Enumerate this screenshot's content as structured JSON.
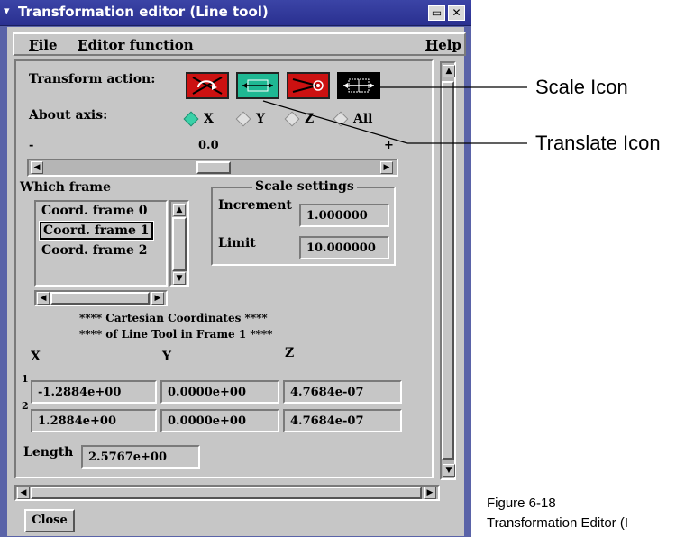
{
  "window": {
    "title": "Transformation editor (Line tool)",
    "minimize_symbol": "▭",
    "close_symbol": "✕"
  },
  "menu": {
    "file": {
      "underline": "F",
      "rest": "ile"
    },
    "editor_function": {
      "underline": "E",
      "rest": "ditor function"
    },
    "help": {
      "underline": "H",
      "rest": "elp"
    }
  },
  "transform_action": {
    "label": "Transform action:",
    "icons": [
      "rotate-icon",
      "translate-icon",
      "stretch-icon",
      "scale-icon"
    ]
  },
  "about_axis": {
    "label": "About axis:",
    "options": [
      "X",
      "Y",
      "Z",
      "All"
    ],
    "selected": "X"
  },
  "slider": {
    "min_label": "-",
    "value_label": "0.0",
    "max_label": "+"
  },
  "which_frame": {
    "label": "Which frame",
    "items": [
      "Coord. frame 0",
      "Coord. frame 1",
      "Coord. frame 2"
    ],
    "selected_index": 1
  },
  "scale_settings": {
    "title": "Scale settings",
    "increment_label": "Increment",
    "increment_value": "1.000000",
    "limit_label": "Limit",
    "limit_value": "10.000000"
  },
  "coords": {
    "heading_1": "**** Cartesian Coordinates ****",
    "heading_2": "**** of Line Tool in Frame 1 ****",
    "col_x": "X",
    "col_y": "Y",
    "col_z": "Z",
    "row_labels": [
      "1",
      "2"
    ],
    "rows": [
      [
        "-1.2884e+00",
        "0.0000e+00",
        "4.7684e-07"
      ],
      [
        "1.2884e+00",
        "0.0000e+00",
        "4.7684e-07"
      ]
    ],
    "length_label": "Length",
    "length_value": "2.5767e+00"
  },
  "buttons": {
    "close": "Close"
  },
  "annotations": {
    "scale_icon": "Scale Icon",
    "translate_icon": "Translate Icon",
    "figure_number": "Figure 6-18",
    "figure_caption": "Transformation Editor (I"
  },
  "colors": {
    "title_bar": "#2a3090",
    "panel": "#c6c6c6",
    "radio_selected": "#3ad1a8",
    "rotate_bg": "#cc1111",
    "translate_bg": "#1fb893",
    "stretch_bg": "#cc1111",
    "scale_bg": "#000000"
  }
}
